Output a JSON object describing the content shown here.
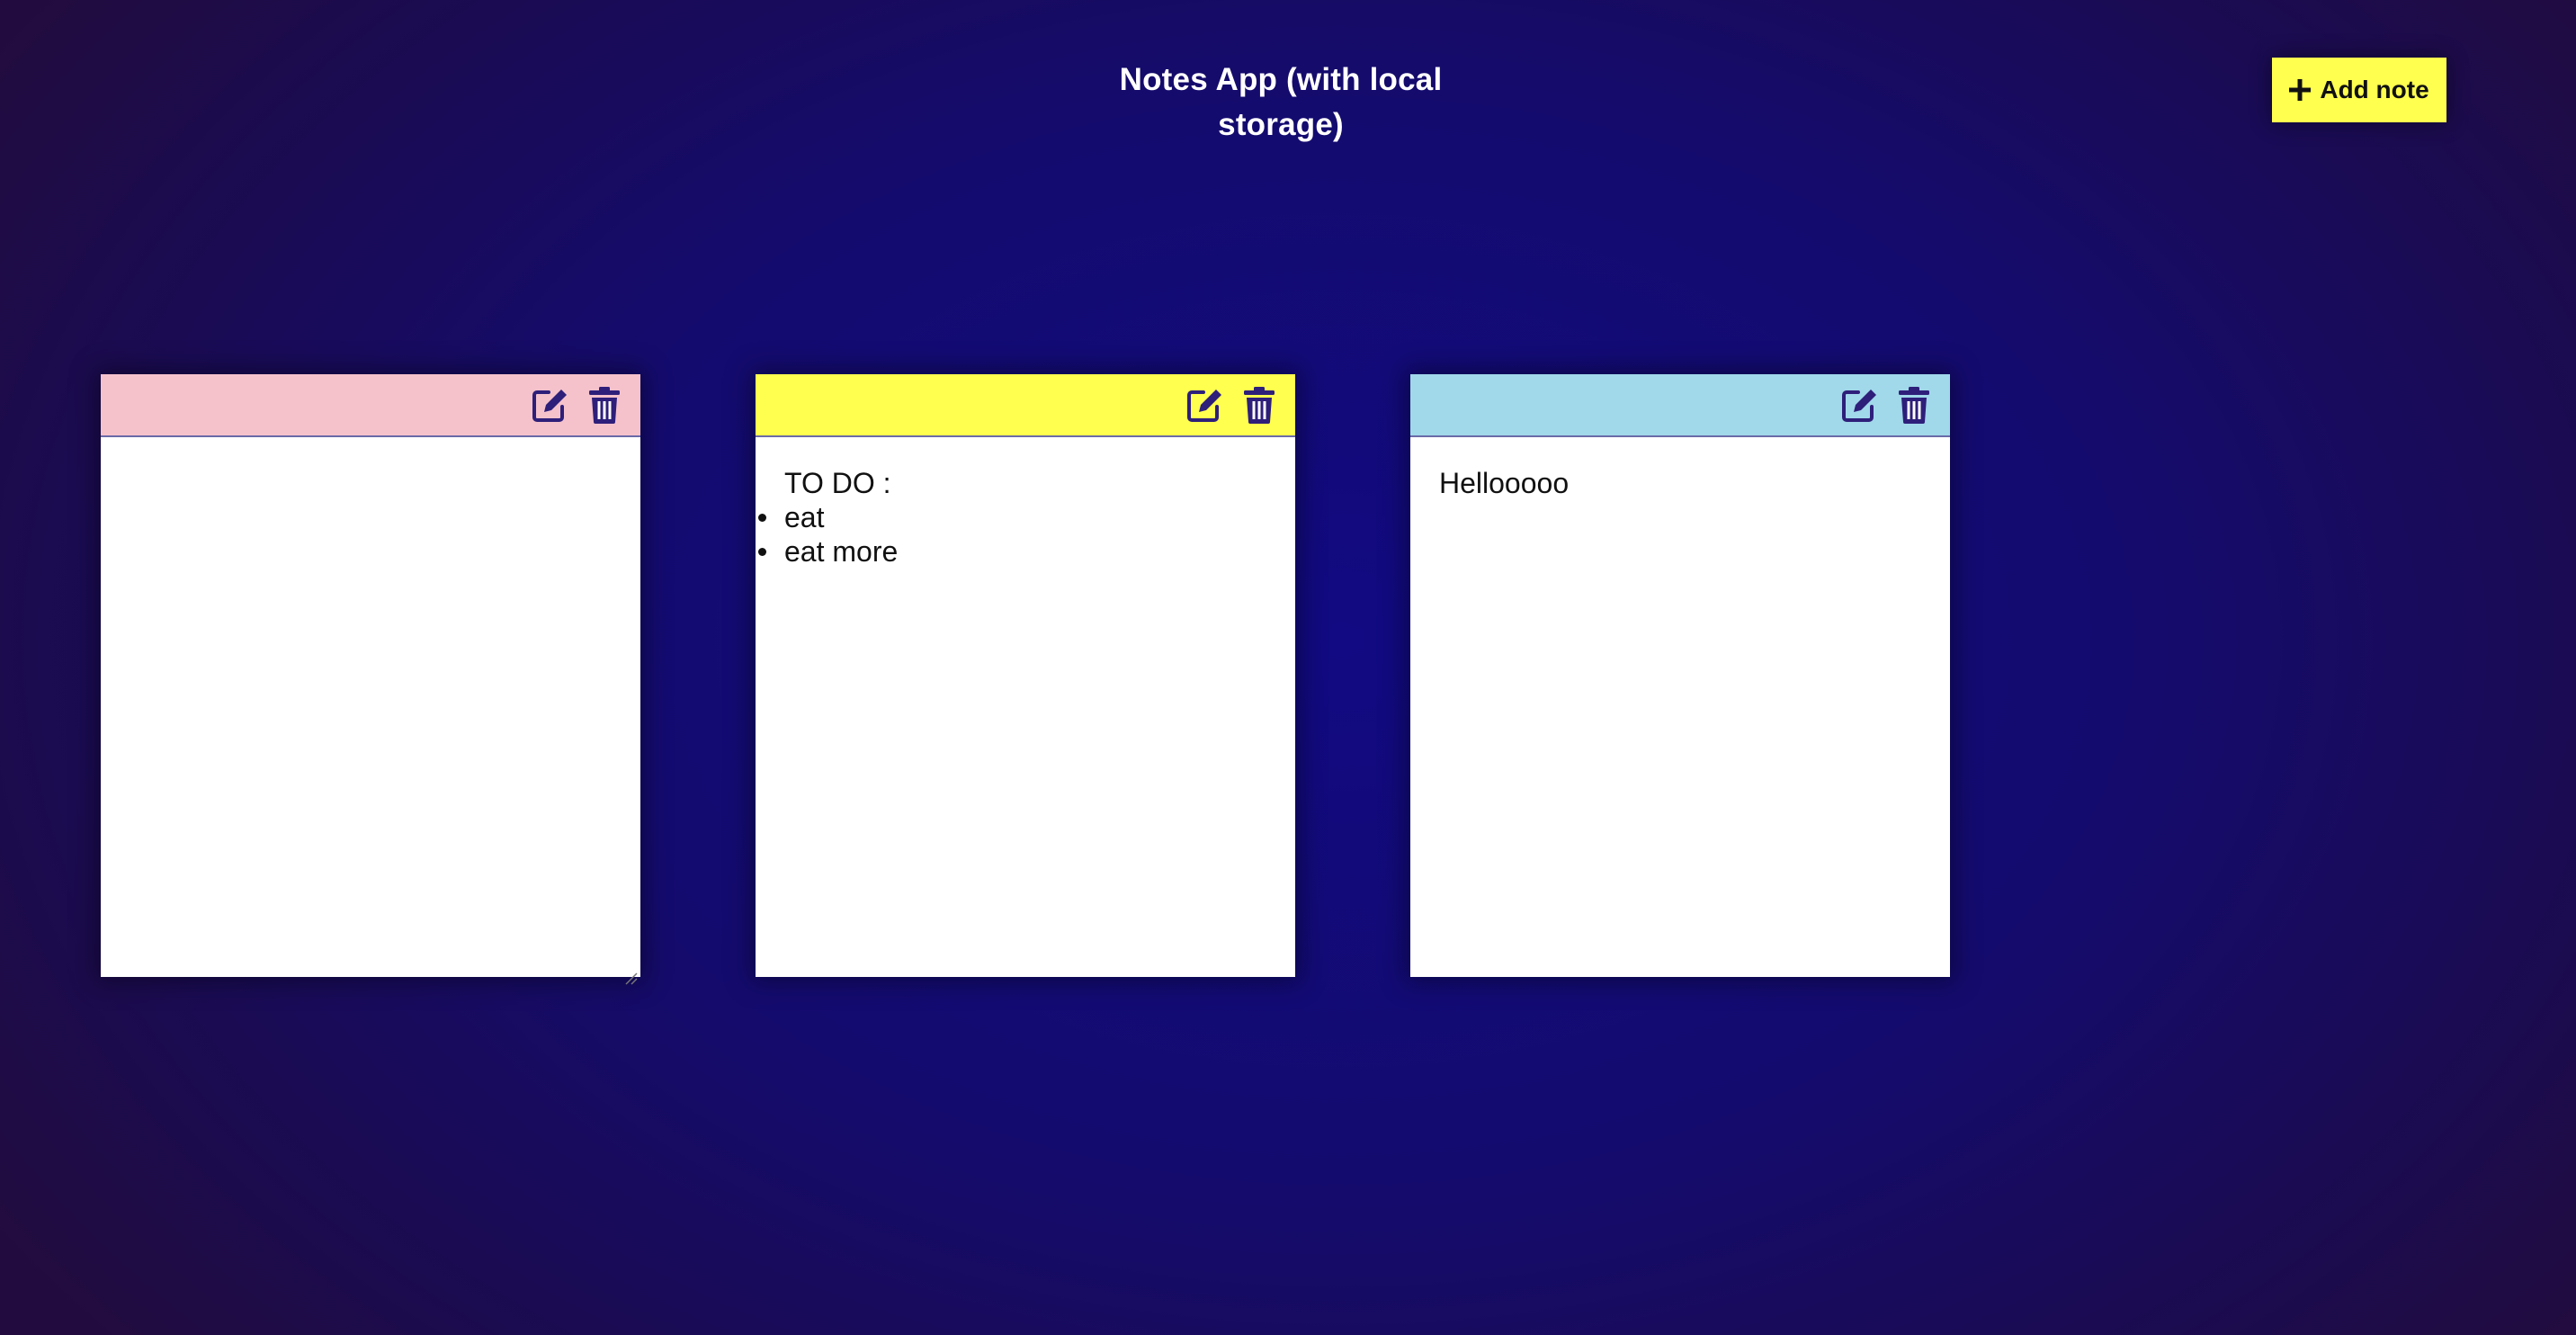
{
  "app": {
    "title": "Notes App (with local storage)"
  },
  "toolbar": {
    "add_note_label": "Add note",
    "add_note_icon": "plus-icon",
    "button_color": "#ffff4f"
  },
  "notes": [
    {
      "header_color": "#f5c2cc",
      "mode": "editing",
      "text": "",
      "icons": [
        "edit-icon",
        "trash-icon"
      ]
    },
    {
      "header_color": "#ffff4f",
      "mode": "view",
      "heading": "TO DO :",
      "items": [
        "eat",
        "eat more"
      ],
      "icons": [
        "edit-icon",
        "trash-icon"
      ]
    },
    {
      "header_color": "#a1d8ea",
      "mode": "view",
      "text": "Hellooooo",
      "icons": [
        "edit-icon",
        "trash-icon"
      ]
    }
  ],
  "colors": {
    "background_center": "#110a82",
    "background_edge": "#220c3f",
    "icon": "#2e1f7a"
  }
}
